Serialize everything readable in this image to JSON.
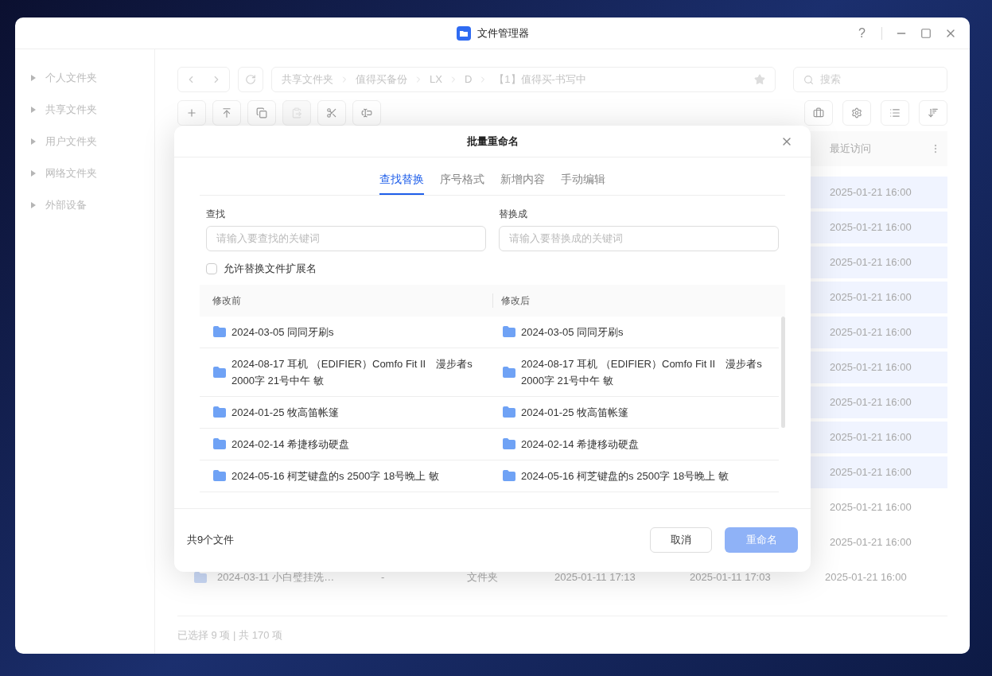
{
  "window": {
    "title": "文件管理器",
    "controls": [
      "?"
    ]
  },
  "sidebar": {
    "items": [
      {
        "label": "个人文件夹",
        "expanded": false
      },
      {
        "label": "共享文件夹",
        "expanded": false
      },
      {
        "label": "用户文件夹",
        "expanded": false
      },
      {
        "label": "网络文件夹",
        "expanded": false
      },
      {
        "label": "外部设备",
        "expanded": false
      }
    ]
  },
  "breadcrumb": [
    "共享文件夹",
    "值得买备份",
    "LX",
    "D",
    "【1】值得买-书写中"
  ],
  "search": {
    "placeholder": "搜索"
  },
  "toolbar": [
    {
      "kind": "add",
      "disabled": false
    },
    {
      "kind": "upload",
      "disabled": false
    },
    {
      "kind": "copy",
      "disabled": false
    },
    {
      "kind": "paste",
      "disabled": true
    },
    {
      "kind": "cut",
      "disabled": false
    },
    {
      "kind": "rename",
      "disabled": false
    }
  ],
  "file_list": {
    "columns": [
      "最近访问"
    ],
    "rows": [
      {
        "accessed": "2025-01-21 16:00",
        "selected": true
      },
      {
        "accessed": "2025-01-21 16:00",
        "selected": true
      },
      {
        "accessed": "2025-01-21 16:00",
        "selected": true
      },
      {
        "accessed": "2025-01-21 16:00",
        "selected": true
      },
      {
        "accessed": "2025-01-21 16:00",
        "selected": true
      },
      {
        "accessed": "2025-01-21 16:00",
        "selected": true
      },
      {
        "accessed": "2025-01-21 16:00",
        "selected": true
      },
      {
        "accessed": "2025-01-21 16:00",
        "selected": true
      },
      {
        "accessed": "2025-01-21 16:00",
        "selected": true
      },
      {
        "accessed": "2025-01-21 16:00",
        "selected": false
      },
      {
        "accessed": "2025-01-21 16:00",
        "selected": false
      },
      {
        "name": "2024-03-11 小白璧挂洗…",
        "size": "-",
        "type": "文件夹",
        "modified": "2025-01-11 17:13",
        "created": "2025-01-11 17:03",
        "accessed": "2025-01-21 16:00",
        "selected": false
      }
    ]
  },
  "status_bar": "已选择 9 项 | 共 170 项",
  "dialog": {
    "title": "批量重命名",
    "tabs": [
      {
        "label": "查找替换",
        "selected": true
      },
      {
        "label": "序号格式",
        "selected": false
      },
      {
        "label": "新增内容",
        "selected": false
      },
      {
        "label": "手动编辑",
        "selected": false
      }
    ],
    "find": {
      "label": "查找",
      "placeholder": "请输入要查找的关键词"
    },
    "replace": {
      "label": "替换成",
      "placeholder": "请输入要替换成的关键词"
    },
    "allow_extension": {
      "label": "允许替换文件扩展名",
      "checked": false
    },
    "columns": [
      "修改前",
      "修改后"
    ],
    "rows": [
      {
        "before": "2024-03-05 同同牙刷s",
        "after": "2024-03-05 同同牙刷s"
      },
      {
        "before": "2024-08-17 耳机 （EDIFIER）Comfo Fit II　漫步者s　2000字  21号中午  敏",
        "after": "2024-08-17 耳机 （EDIFIER）Comfo Fit II　漫步者s　2000字  21号中午  敏"
      },
      {
        "before": "2024-01-25 牧高笛帐篷",
        "after": "2024-01-25 牧高笛帐篷"
      },
      {
        "before": "2024-02-14 希捷移动硬盘",
        "after": "2024-02-14 希捷移动硬盘"
      },
      {
        "before": "2024-05-16 柯芝键盘的s  2500字  18号晚上  敏",
        "after": "2024-05-16 柯芝键盘的s  2500字  18号晚上  敏"
      }
    ],
    "count": "共9个文件",
    "cancel": "取消",
    "confirm": {
      "label": "重命名",
      "disabled": true
    }
  }
}
